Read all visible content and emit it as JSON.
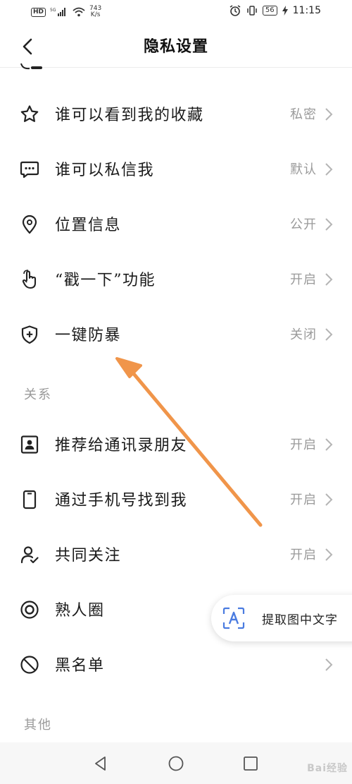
{
  "status_bar": {
    "hd": "HD",
    "signal_tag": "5G",
    "speed_value": "743",
    "speed_unit": "K/s",
    "battery": "56",
    "time": "11:15"
  },
  "header": {
    "title": "隐私设置"
  },
  "privacy_items": [
    {
      "label": "谁可以看到我的收藏",
      "value": "私密",
      "icon": "star-icon"
    },
    {
      "label": "谁可以私信我",
      "value": "默认",
      "icon": "message-icon"
    },
    {
      "label": "位置信息",
      "value": "公开",
      "icon": "location-icon"
    },
    {
      "label": "“戳一下”功能",
      "value": "开启",
      "icon": "poke-hand-icon"
    },
    {
      "label": "一键防暴",
      "value": "关闭",
      "icon": "shield-plus-icon"
    }
  ],
  "relations_section": {
    "title": "关系",
    "items": [
      {
        "label": "推荐给通讯录朋友",
        "value": "开启",
        "icon": "contact-card-icon"
      },
      {
        "label": "通过手机号找到我",
        "value": "开启",
        "icon": "phone-icon"
      },
      {
        "label": "共同关注",
        "value": "开启",
        "icon": "user-check-icon"
      },
      {
        "label": "熟人圈",
        "value": "",
        "icon": "circle-target-icon"
      },
      {
        "label": "黑名单",
        "value": "",
        "icon": "block-icon"
      }
    ]
  },
  "other_section": {
    "title": "其他"
  },
  "ocr_button": {
    "label": "提取图中文字",
    "icon": "text-scan-icon"
  },
  "watermark": "Bai经验",
  "colors": {
    "arrow": "#f0954a",
    "value_text": "#9a9a9a",
    "ocr_accent": "#4a7be0"
  }
}
